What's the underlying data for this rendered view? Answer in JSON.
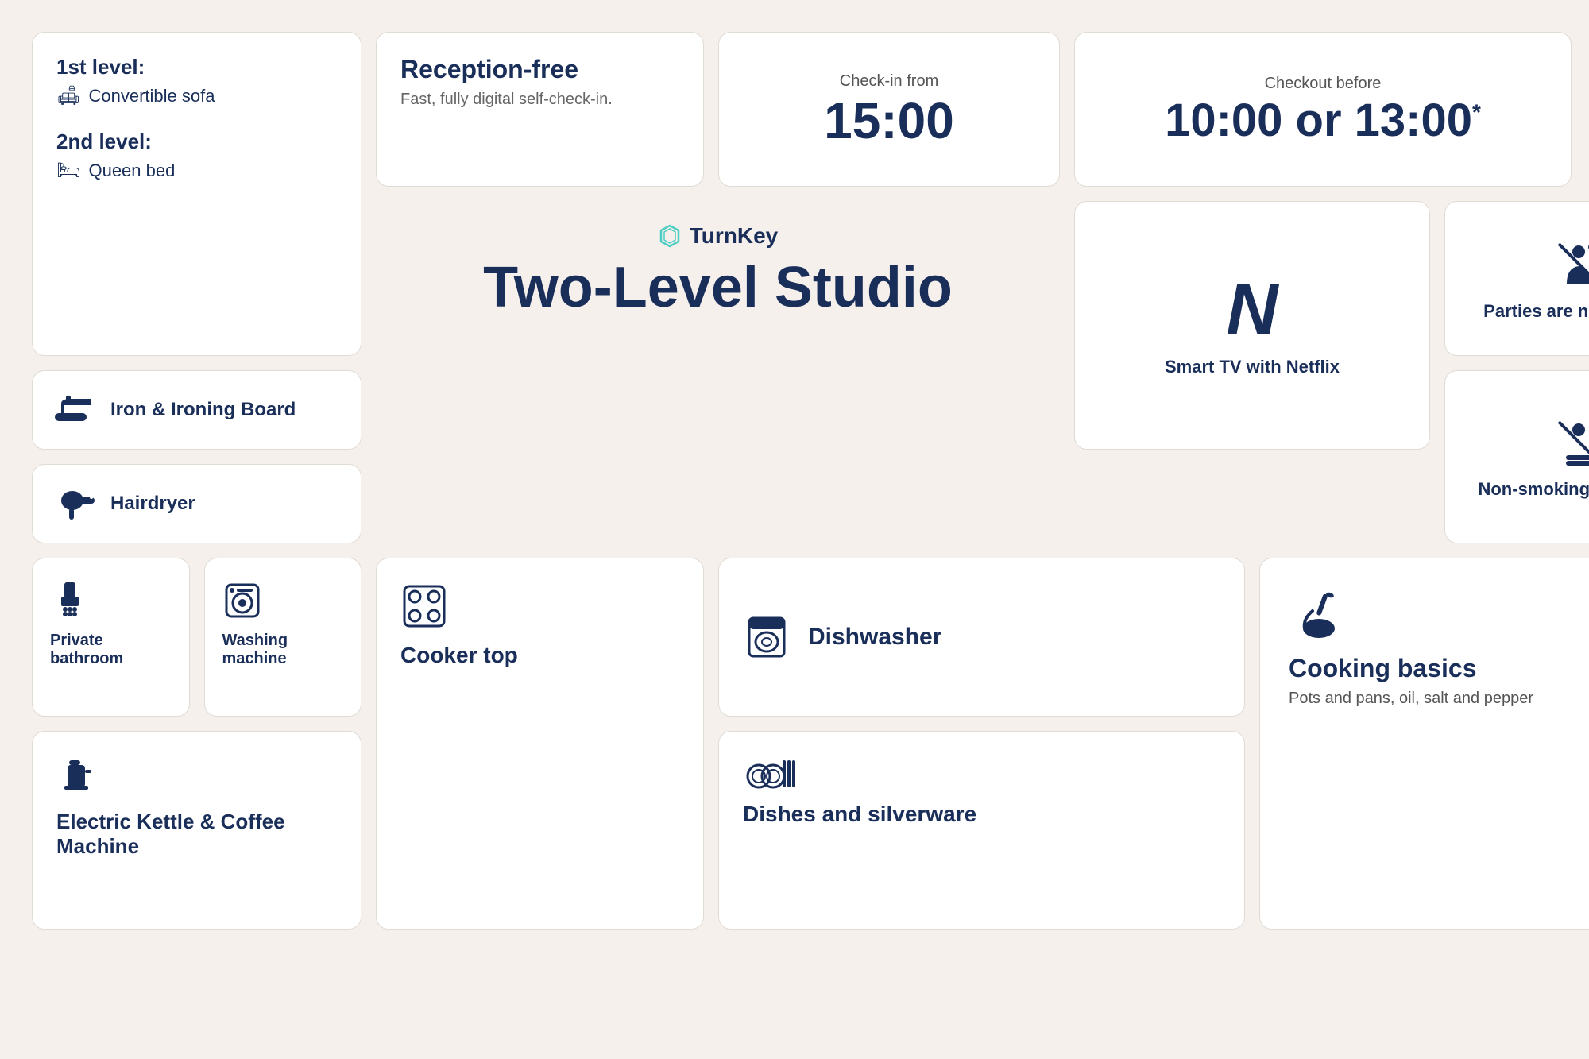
{
  "beds": {
    "level1_title": "1st level:",
    "level1_item": "Convertible sofa",
    "level2_title": "2nd level:",
    "level2_item": "Queen bed"
  },
  "reception": {
    "title": "Reception-free",
    "subtitle": "Fast, fully digital self-check-in."
  },
  "checkin": {
    "label": "Check-in from",
    "time": "15:00"
  },
  "checkout": {
    "label": "Checkout before",
    "time": "10:00 or 13:00",
    "asterisk": "*"
  },
  "iron": {
    "label": "Iron & Ironing Board"
  },
  "hairdryer": {
    "label": "Hairdryer"
  },
  "bathroom": {
    "label": "Private bathroom"
  },
  "washing": {
    "label": "Washing machine"
  },
  "center": {
    "brand": "TurnKey",
    "title": "Two-Level Studio"
  },
  "smarttv": {
    "netflix": "N",
    "label": "Smart TV with Netflix"
  },
  "parties": {
    "label": "Parties are not allowed"
  },
  "nosmoking": {
    "label": "Non-smoking apartment"
  },
  "kettle": {
    "label": "Electric Kettle & Coffee Machine"
  },
  "cooker": {
    "label": "Cooker top"
  },
  "dishwasher": {
    "label": "Dishwasher"
  },
  "dishes": {
    "label": "Dishes and silverware"
  },
  "cooking": {
    "label": "Cooking basics",
    "sublabel": "Pots and pans, oil, salt and pepper"
  }
}
